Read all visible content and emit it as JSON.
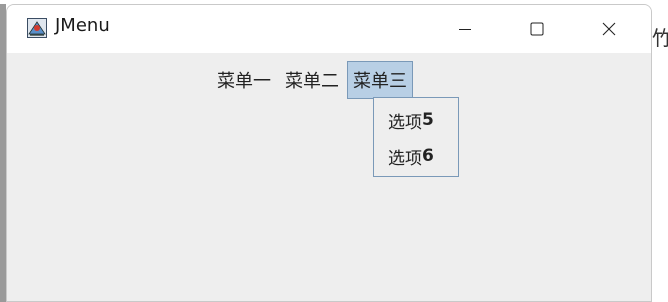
{
  "window": {
    "title": "JMenu",
    "icon": "java-app-icon",
    "controls": {
      "minimize_icon": "minimize-icon",
      "maximize_icon": "maximize-icon",
      "close_icon": "close-icon"
    }
  },
  "menubar": {
    "menus": [
      {
        "label": "菜单一",
        "active": false
      },
      {
        "label": "菜单二",
        "active": false
      },
      {
        "label": "菜单三",
        "active": true
      }
    ]
  },
  "dropdown": {
    "items": [
      {
        "label": "选项",
        "number": "5"
      },
      {
        "label": "选项",
        "number": "6"
      }
    ]
  },
  "background": {
    "right_edge_glyph": "竹"
  },
  "colors": {
    "active_menu_bg": "#b8cfe5",
    "active_menu_border": "#7a99b8",
    "window_bg": "#eeeeee",
    "titlebar_bg": "#ffffff"
  }
}
